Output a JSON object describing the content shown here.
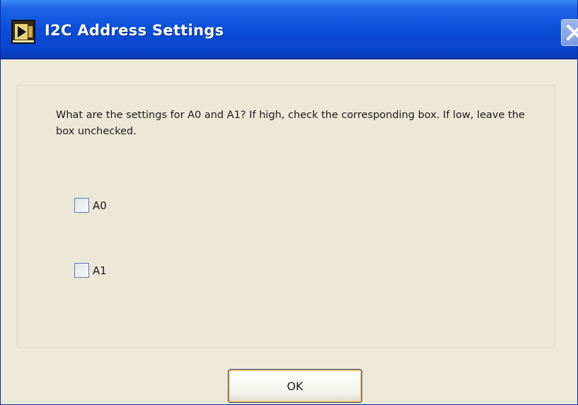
{
  "window": {
    "title": "I2C Address Settings",
    "icon": "labview-vi-icon",
    "close_icon": "close-icon"
  },
  "dialog": {
    "prompt": "What are the settings for A0 and A1? If high, check the corresponding box. If low, leave the box unchecked.",
    "checkboxes": [
      {
        "label": "A0",
        "checked": false
      },
      {
        "label": "A1",
        "checked": false
      }
    ],
    "ok_label": "OK"
  },
  "colors": {
    "titlebar": "#0a4fd8",
    "face": "#ece9d8",
    "focus_ring": "#f7c562"
  }
}
